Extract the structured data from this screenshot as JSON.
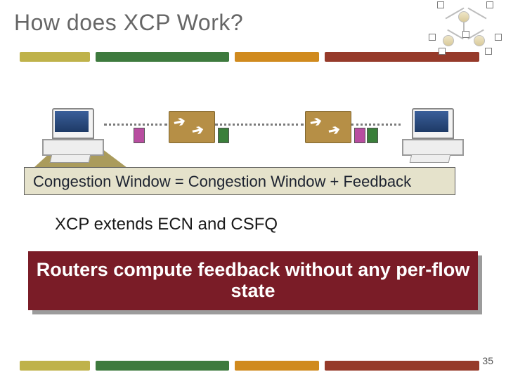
{
  "slide": {
    "title": "How does XCP Work?",
    "formula": "Congestion Window = Congestion Window + Feedback",
    "caption": "XCP extends ECN and CSFQ",
    "banner": "Routers compute feedback without any per-flow state",
    "slide_number": "35"
  },
  "colors": {
    "bar_olive": "#bfb24a",
    "bar_green": "#3e7a3e",
    "bar_amber": "#d08a1e",
    "bar_rust": "#963a2a",
    "banner_bg": "#7a1c27"
  }
}
